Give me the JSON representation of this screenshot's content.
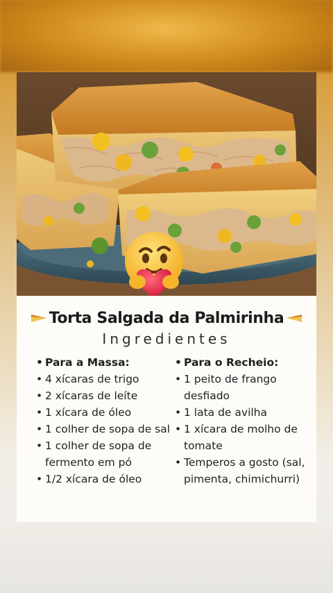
{
  "card": {
    "title": "Torta Salgada da Palmirinha",
    "subtitle": "Ingredientes",
    "left_column": {
      "heading": "Para a Massa:",
      "items": [
        "4 xícaras de trigo",
        "2 xícaras de leíte",
        "1 xícara de óleo",
        "1 colher de sopa de sal",
        "1 colher de sopa de fermento em pó",
        "1/2 xícara de óleo"
      ]
    },
    "right_column": {
      "heading": "Para o Recheio:",
      "items": [
        "1 peito de frango desfiado",
        "1 lata de avilha",
        "1 xícara de molho de tomate",
        "Temperos a gosto (sal, pimenta, chimichurri)"
      ]
    }
  },
  "icons": {
    "title_left": "pie-slice-icon",
    "title_right": "pie-slice-icon",
    "reaction": "hugging-face-emoji-icon"
  }
}
